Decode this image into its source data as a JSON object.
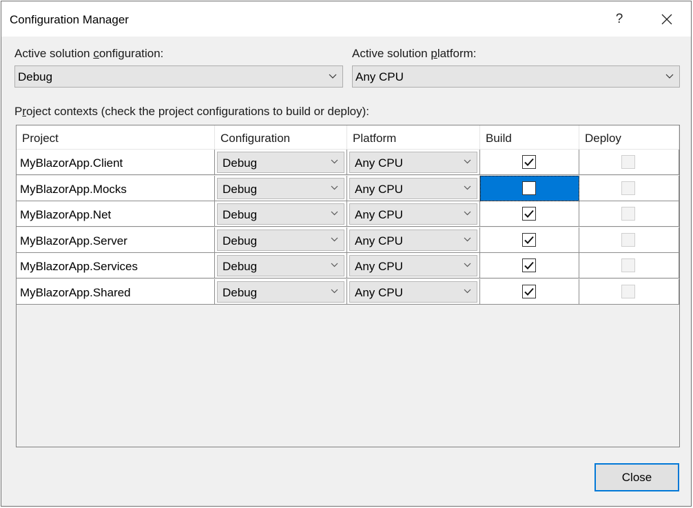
{
  "window": {
    "title": "Configuration Manager",
    "help_glyph": "?"
  },
  "solution": {
    "configuration": {
      "label_prefix": "Active solution ",
      "label_accel": "c",
      "label_suffix": "onfiguration:",
      "value": "Debug"
    },
    "platform": {
      "label_prefix": "Active solution ",
      "label_accel": "p",
      "label_suffix": "latform:",
      "value": "Any CPU"
    }
  },
  "contexts": {
    "label_prefix": "P",
    "label_accel": "r",
    "label_suffix": "oject contexts (check the project configurations to build or deploy):",
    "columns": [
      "Project",
      "Configuration",
      "Platform",
      "Build",
      "Deploy"
    ],
    "rows": [
      {
        "project": "MyBlazorApp.Client",
        "configuration": "Debug",
        "platform": "Any CPU",
        "build": true,
        "deploy": false
      },
      {
        "project": "MyBlazorApp.Mocks",
        "configuration": "Debug",
        "platform": "Any CPU",
        "build": false,
        "deploy": false,
        "selected": true
      },
      {
        "project": "MyBlazorApp.Net",
        "configuration": "Debug",
        "platform": "Any CPU",
        "build": true,
        "deploy": false
      },
      {
        "project": "MyBlazorApp.Server",
        "configuration": "Debug",
        "platform": "Any CPU",
        "build": true,
        "deploy": false
      },
      {
        "project": "MyBlazorApp.Services",
        "configuration": "Debug",
        "platform": "Any CPU",
        "build": true,
        "deploy": false
      },
      {
        "project": "MyBlazorApp.Shared",
        "configuration": "Debug",
        "platform": "Any CPU",
        "build": true,
        "deploy": false
      }
    ]
  },
  "buttons": {
    "close": "Close"
  },
  "colors": {
    "accent": "#0078d7",
    "background": "#f0f0f0"
  }
}
